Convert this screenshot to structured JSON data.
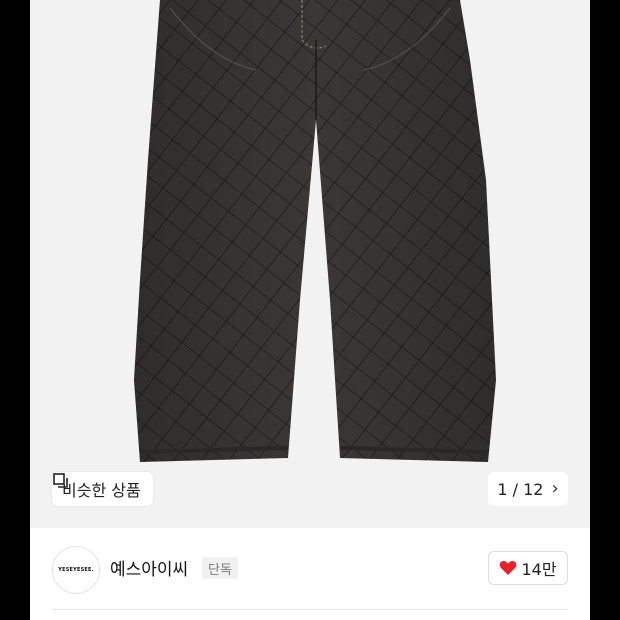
{
  "image_overlay": {
    "similar_label": "비슷한 상품",
    "pager": {
      "text": "1 / 12"
    }
  },
  "brand": {
    "logo_text": "YESEYESEE.",
    "name": "예스아이씨",
    "badge": "단독"
  },
  "like": {
    "count": "14만"
  },
  "colors": {
    "heart": "#e8212b",
    "image_bg": "#f2f2f2",
    "pants": "#3b3836"
  },
  "icons": {
    "similar": "copy-icon",
    "pager_next": "chevron-right-icon",
    "like": "heart-icon"
  }
}
